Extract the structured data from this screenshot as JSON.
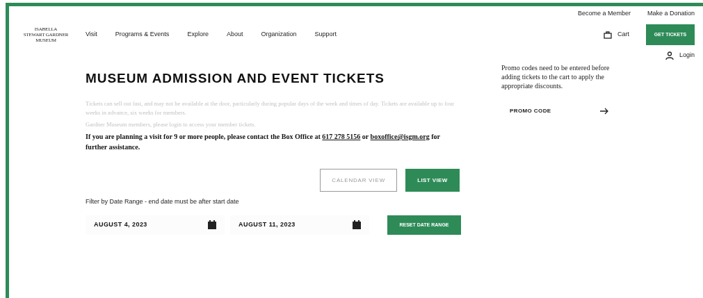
{
  "logo": {
    "lines": [
      "ISABELLA",
      "STEWART GARDNER",
      "MUSEUM"
    ]
  },
  "nav": [
    "Visit",
    "Programs & Events",
    "Explore",
    "About",
    "Organization",
    "Support"
  ],
  "utility_links": [
    "Become a Member",
    "Make a Donation"
  ],
  "cart": {
    "label": "Cart"
  },
  "get_tickets": "GET TICKETS",
  "login": "Login",
  "heading": "MUSEUM ADMISSION AND EVENT TICKETS",
  "faded_paragraphs": [
    "Tickets can sell out fast, and may not be available at the door, particularly during popular days of the week and times of day. Tickets are available up to four weeks in advance, six weeks for members.",
    "Gardner Museum members, please login to access your member tickets."
  ],
  "group_notice": {
    "text": "If you are planning a visit for 9 or more people, please contact the Box Office at",
    "phone": "617 278 5156",
    "joiner": "or",
    "email": "boxoffice@isgm.org",
    "tail": "for further assistance."
  },
  "view_toggle": [
    {
      "label": "CALENDAR VIEW",
      "selected": false
    },
    {
      "label": "LIST VIEW",
      "selected": true
    }
  ],
  "filter_label": "Filter by Date Range - end date must be after start date",
  "start_date": "AUGUST 4, 2023",
  "end_date": "AUGUST 11, 2023",
  "reset_button": "RESET DATE RANGE",
  "promo_note": "Promo codes need to be entered before adding tickets to the cart to apply the appropriate discounts.",
  "promo_code": "PROMO CODE"
}
